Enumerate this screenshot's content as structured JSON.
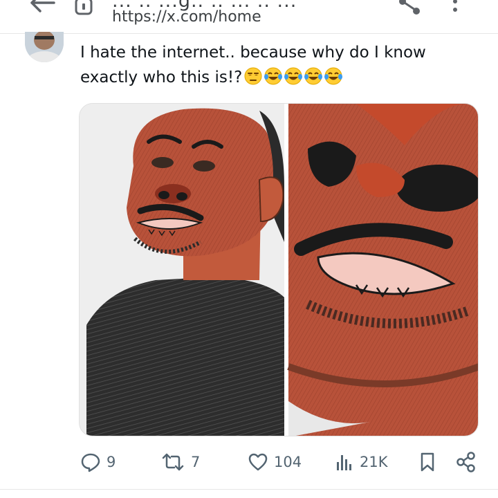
{
  "browser": {
    "title_partial": "... .. ...g.. .. ... .. ...",
    "url": "https://x.com/home"
  },
  "tweet": {
    "text": "I hate the internet.. because why do I know exactly who this is!?",
    "emojis": [
      "unamused-face",
      "face-with-tears-of-joy",
      "face-with-tears-of-joy",
      "face-with-tears-of-joy",
      "face-with-tears-of-joy"
    ],
    "media": {
      "description_icons": [
        "drawing-left-panel",
        "drawing-right-panel"
      ]
    }
  },
  "actions": {
    "replies": "9",
    "reposts": "7",
    "likes": "104",
    "views": "21K"
  },
  "colors": {
    "text": "#0f1419",
    "muted": "#536471",
    "chrome_text": "#3c4043",
    "emoji_yellow": "#ffcc33",
    "emoji_tear": "#3b9cf0"
  }
}
